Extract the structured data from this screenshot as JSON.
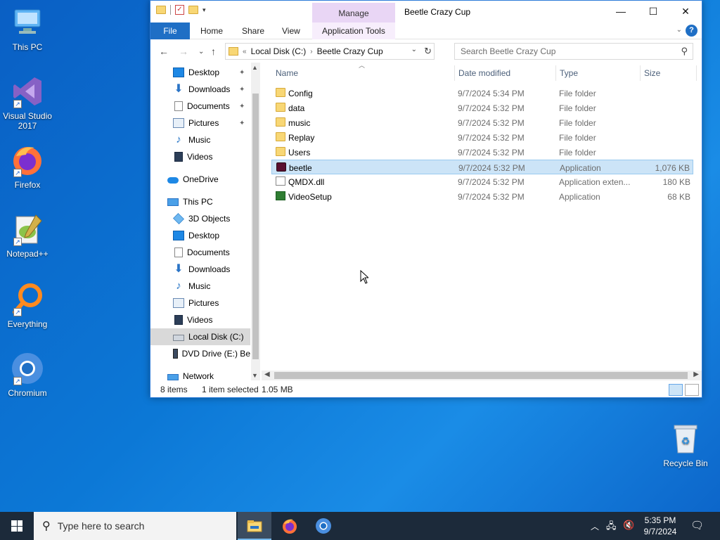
{
  "desktop": {
    "icons": [
      {
        "label": "This PC"
      },
      {
        "label": "Visual Studio 2017"
      },
      {
        "label": "Firefox"
      },
      {
        "label": "Notepad++"
      },
      {
        "label": "Everything"
      },
      {
        "label": "Chromium"
      },
      {
        "label": "Recycle Bin"
      }
    ]
  },
  "window": {
    "title": "Beetle Crazy Cup",
    "contextual_tab": "Manage",
    "controls": {
      "minimize": "—",
      "maximize": "☐",
      "close": "✕"
    },
    "ribbon_tabs": [
      "File",
      "Home",
      "Share",
      "View",
      "Application Tools"
    ],
    "help": "?",
    "address": {
      "prefix": "«",
      "crumbs": [
        "Local Disk (C:)",
        "Beetle Crazy Cup"
      ]
    },
    "search_placeholder": "Search Beetle Crazy Cup",
    "nav": {
      "items": [
        {
          "label": "Desktop",
          "pinned": true
        },
        {
          "label": "Downloads",
          "pinned": true
        },
        {
          "label": "Documents",
          "pinned": true
        },
        {
          "label": "Pictures",
          "pinned": true
        },
        {
          "label": "Music"
        },
        {
          "label": "Videos"
        },
        {
          "label": "OneDrive"
        },
        {
          "label": "This PC"
        },
        {
          "label": "3D Objects"
        },
        {
          "label": "Desktop"
        },
        {
          "label": "Documents"
        },
        {
          "label": "Downloads"
        },
        {
          "label": "Music"
        },
        {
          "label": "Pictures"
        },
        {
          "label": "Videos"
        },
        {
          "label": "Local Disk (C:)",
          "selected": true
        },
        {
          "label": "DVD Drive (E:) Be"
        },
        {
          "label": "Network"
        }
      ]
    },
    "columns": {
      "name": "Name",
      "date": "Date modified",
      "type": "Type",
      "size": "Size"
    },
    "files": [
      {
        "name": "Config",
        "date": "9/7/2024 5:34 PM",
        "type": "File folder",
        "size": "",
        "icon": "folder-icon"
      },
      {
        "name": "data",
        "date": "9/7/2024 5:32 PM",
        "type": "File folder",
        "size": "",
        "icon": "folder-icon"
      },
      {
        "name": "music",
        "date": "9/7/2024 5:32 PM",
        "type": "File folder",
        "size": "",
        "icon": "folder-icon"
      },
      {
        "name": "Replay",
        "date": "9/7/2024 5:32 PM",
        "type": "File folder",
        "size": "",
        "icon": "folder-icon"
      },
      {
        "name": "Users",
        "date": "9/7/2024 5:32 PM",
        "type": "File folder",
        "size": "",
        "icon": "folder-icon"
      },
      {
        "name": "beetle",
        "date": "9/7/2024 5:32 PM",
        "type": "Application",
        "size": "1,076 KB",
        "icon": "beetle-app-icon",
        "selected": true
      },
      {
        "name": "QMDX.dll",
        "date": "9/7/2024 5:32 PM",
        "type": "Application exten...",
        "size": "180 KB",
        "icon": "dll-file-icon"
      },
      {
        "name": "VideoSetup",
        "date": "9/7/2024 5:32 PM",
        "type": "Application",
        "size": "68 KB",
        "icon": "video-setup-icon"
      }
    ],
    "status": {
      "count": "8 items",
      "selection": "1 item selected",
      "size": "1.05 MB"
    }
  },
  "taskbar": {
    "search_placeholder": "Type here to search",
    "time": "5:35 PM",
    "date": "9/7/2024"
  },
  "colors": {
    "accent": "#1f6fc5",
    "selection": "#cce4f7",
    "manage_tab": "#e9d6f5"
  }
}
